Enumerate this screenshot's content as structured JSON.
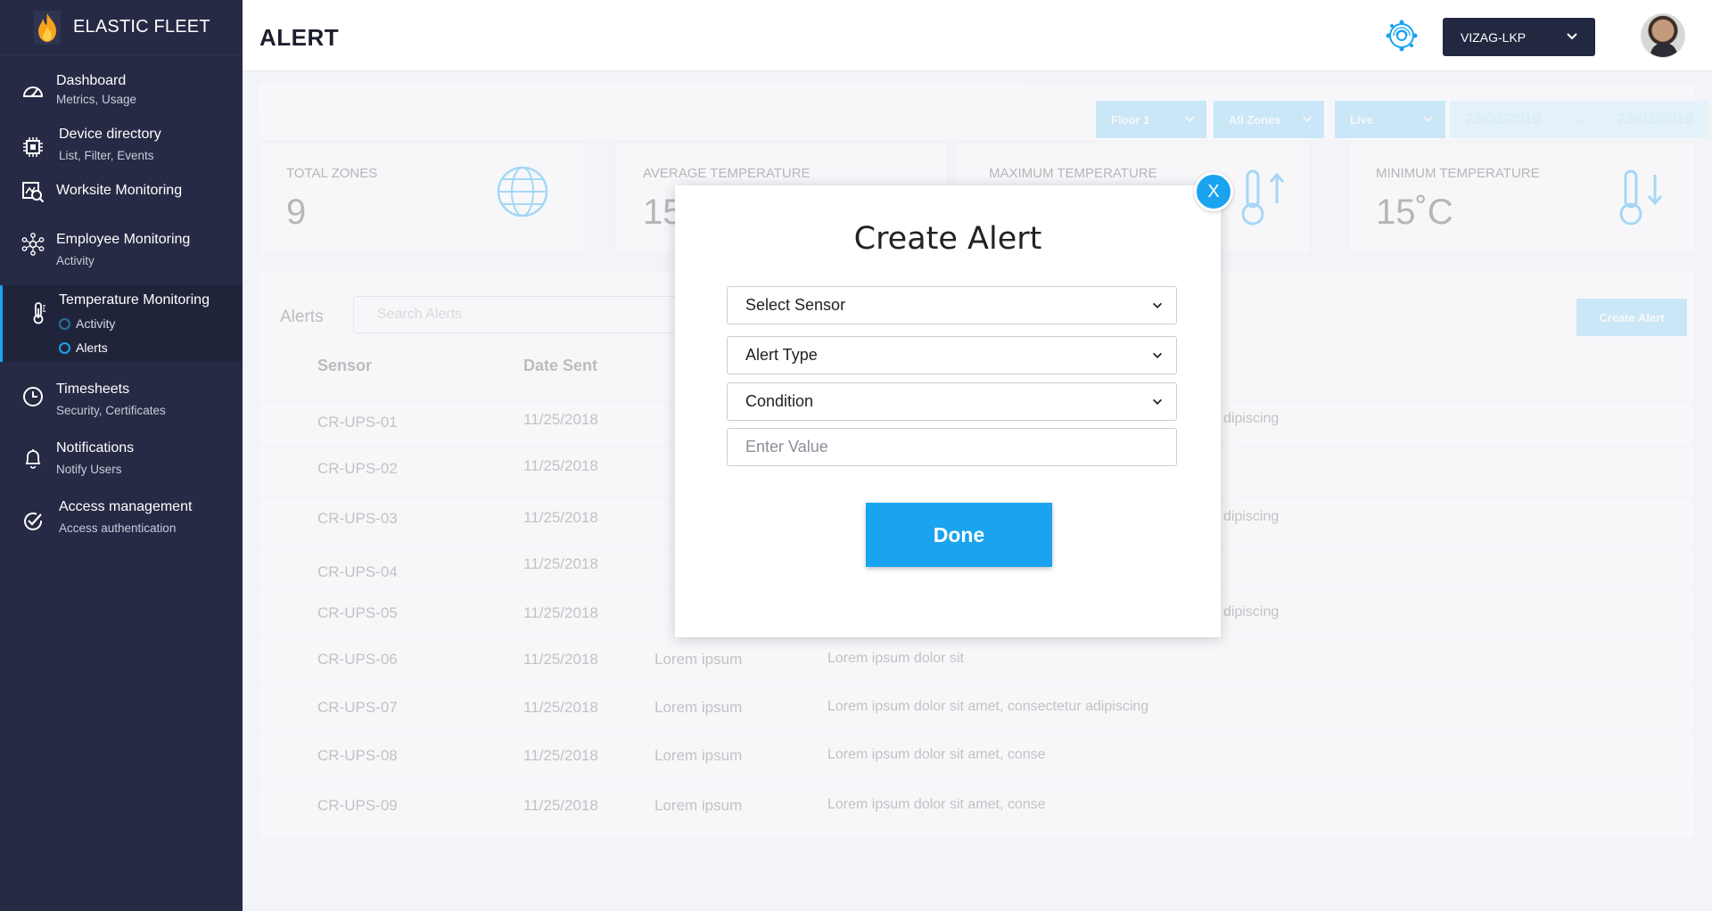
{
  "app": {
    "brand": "ELASTIC FLEET"
  },
  "sidebar": {
    "items": [
      {
        "label": "Dashboard",
        "sub": "Metrics, Usage",
        "icon": "gauge-icon"
      },
      {
        "label": "Device directory",
        "sub": "List, Filter, Events",
        "icon": "chip-icon"
      },
      {
        "label": "Worksite Monitoring",
        "sub": "",
        "icon": "worksite-icon"
      },
      {
        "label": "Employee Monitoring",
        "sub": "Activity",
        "icon": "network-people-icon"
      },
      {
        "label": "Temperature Monitoring",
        "sub": "",
        "icon": "thermometer-icon",
        "children": [
          {
            "label": "Activity"
          },
          {
            "label": "Alerts"
          }
        ]
      },
      {
        "label": "Timesheets",
        "sub": "Security, Certificates",
        "icon": "clock-icon"
      },
      {
        "label": "Notifications",
        "sub": "Notify Users",
        "icon": "bell-icon"
      },
      {
        "label": "Access management",
        "sub": "Access authentication",
        "icon": "check-circle-icon"
      }
    ]
  },
  "header": {
    "title": "ALERT",
    "site": "VIZAG-LKP"
  },
  "filters": {
    "floor": "Floor 1",
    "zones": "All Zones",
    "mode": "Live",
    "date_from": "23/03/2019",
    "date_sep": "→",
    "date_to": "23/03/2019"
  },
  "stats": [
    {
      "label": "TOTAL ZONES",
      "value": "9"
    },
    {
      "label": "AVERAGE TEMPERATURE",
      "value": "15"
    },
    {
      "label": "MAXIMUM TEMPERATURE",
      "value": ""
    },
    {
      "label": "MINIMUM TEMPERATURE",
      "value": "15˚C"
    }
  ],
  "alerts": {
    "label": "Alerts",
    "search_placeholder": "Search Alerts",
    "create_label": "Create Alert",
    "columns": {
      "sensor": "Sensor",
      "date": "Date Sent"
    },
    "rows": [
      {
        "sensor": "CR-UPS-01",
        "date": "11/25/2018",
        "type": "",
        "desc": "dipiscing"
      },
      {
        "sensor": "CR-UPS-02",
        "date": "11/25/2018",
        "type": "",
        "desc": ""
      },
      {
        "sensor": "CR-UPS-03",
        "date": "11/25/2018",
        "type": "",
        "desc": "dipiscing"
      },
      {
        "sensor": "CR-UPS-04",
        "date": "11/25/2018",
        "type": "",
        "desc": ""
      },
      {
        "sensor": "CR-UPS-05",
        "date": "11/25/2018",
        "type": "",
        "desc": "dipiscing"
      },
      {
        "sensor": "CR-UPS-06",
        "date": "11/25/2018",
        "type": "Lorem ipsum",
        "desc": "Lorem ipsum dolor sit"
      },
      {
        "sensor": "CR-UPS-07",
        "date": "11/25/2018",
        "type": "Lorem ipsum",
        "desc": "Lorem ipsum dolor sit amet, consectetur adipiscing"
      },
      {
        "sensor": "CR-UPS-08",
        "date": "11/25/2018",
        "type": "Lorem ipsum",
        "desc": "Lorem ipsum dolor sit amet, conse"
      },
      {
        "sensor": "CR-UPS-09",
        "date": "11/25/2018",
        "type": "Lorem ipsum",
        "desc": "Lorem ipsum dolor sit amet, conse"
      }
    ]
  },
  "modal": {
    "title": "Create Alert",
    "close": "X",
    "sensor_label": "Select Sensor",
    "alert_type_label": "Alert Type",
    "condition_label": "Condition",
    "value_placeholder": "Enter Value",
    "done_label": "Done"
  },
  "colors": {
    "sidebar": "#262a44",
    "accent": "#1aa3ef",
    "site_select": "#232841"
  }
}
